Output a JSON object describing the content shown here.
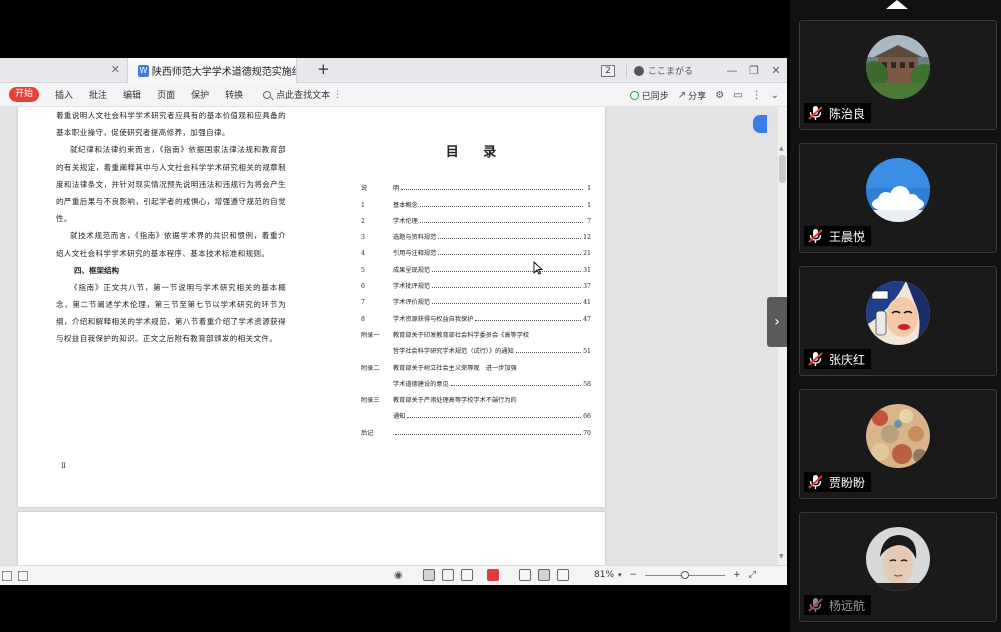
{
  "wps": {
    "tab_blank_close": "✕",
    "doc_tab": {
      "icon": "W",
      "title": "陕西师范大学学术道德规范实施细则"
    },
    "add_tab": "+",
    "tab_count": "2",
    "user_name": "ここまがる",
    "window_buttons": {
      "minimize": "—",
      "restore": "❐",
      "close": "✕"
    }
  },
  "ribbon": {
    "start": "开始",
    "items": [
      "插入",
      "批注",
      "编辑",
      "页面",
      "保护",
      "转换"
    ],
    "search": "点此查找文本",
    "sync": "已同步",
    "share": "分享"
  },
  "document": {
    "left_paragraphs": [
      {
        "text": "着重说明人文社会科学学术研究者应具有的基本价值观和应具备的基本职业操守，促使研究者提高修养，加强自律。",
        "indent": false
      },
      {
        "text": "就纪律和法律约束而言，《指南》依据国家法律法规和教育部的有关规定，着重阐释其中与人文社会科学学术研究相关的规章制度和法律条文，并针对现实情况预先说明违法和违规行为将会产生的严重后果与不良影响，引起学者的戒惧心，增强遵守规范的自觉性。",
        "indent": true
      },
      {
        "text": "就技术规范而言，《指南》依据学术界的共识和惯例，着重介绍人文社会科学学术研究的基本程序、基本技术标准和规则。",
        "indent": true
      }
    ],
    "section_heading": "四、框架结构",
    "left_last_paragraph": "《指南》正文共八节，第一节说明与学术研究相关的基本概念，第二节阐述学术伦理，第三节至第七节以学术研究的环节为纲，介绍和解释相关的学术规范，第八节着重介绍了学术资源获得与权益自我保护的知识。正文之后附有教育部颁发的相关文件。",
    "page_number": "Ⅱ",
    "toc_title": "目 录",
    "toc": [
      {
        "num": "说",
        "text": "明",
        "page": "1"
      },
      {
        "num": "1",
        "text": "基本概念",
        "page": "1"
      },
      {
        "num": "2",
        "text": "学术伦理",
        "page": "7"
      },
      {
        "num": "3",
        "text": "选题与资料规范",
        "page": "12"
      },
      {
        "num": "4",
        "text": "引用与注释规范",
        "page": "21"
      },
      {
        "num": "5",
        "text": "成果呈现规范",
        "page": "31"
      },
      {
        "num": "6",
        "text": "学术批评规范",
        "page": "37"
      },
      {
        "num": "7",
        "text": "学术评价规范",
        "page": "41"
      },
      {
        "num": "8",
        "text": "学术资源获得与权益自我保护",
        "page": "47"
      },
      {
        "num": "附录一",
        "text": "教育部关于印发教育部社会科学委员会《高等学校",
        "page": ""
      },
      {
        "num": "",
        "text": "哲学社会科学研究学术规范（试行）》的通知",
        "page": "51"
      },
      {
        "num": "附录二",
        "text": "教育部关于树立社会主义荣辱观　进一步加强",
        "page": ""
      },
      {
        "num": "",
        "text": "学术道德建设的意见",
        "page": "58"
      },
      {
        "num": "附录三",
        "text": "教育部关于严肃处理高等学校学术不端行为的",
        "page": ""
      },
      {
        "num": "",
        "text": "通知",
        "page": "66"
      },
      {
        "num": "后记",
        "text": "",
        "page": "70"
      }
    ]
  },
  "statusbar": {
    "zoom": "81%",
    "zoom_minus": "−",
    "zoom_plus": "+"
  },
  "participants": [
    {
      "name": "陈治良",
      "muted": true,
      "avatar": "building-photo"
    },
    {
      "name": "王晨悦",
      "muted": true,
      "avatar": "sky-cloud"
    },
    {
      "name": "张庆红",
      "muted": true,
      "avatar": "comic-woman"
    },
    {
      "name": "贾盼盼",
      "muted": true,
      "avatar": "painting"
    },
    {
      "name": "杨远航",
      "muted": true,
      "avatar": "man-portrait"
    }
  ],
  "colors": {
    "start_button": "#e8413a",
    "mic_muted": "#e03b3b",
    "wps_blue": "#3d7be8"
  }
}
